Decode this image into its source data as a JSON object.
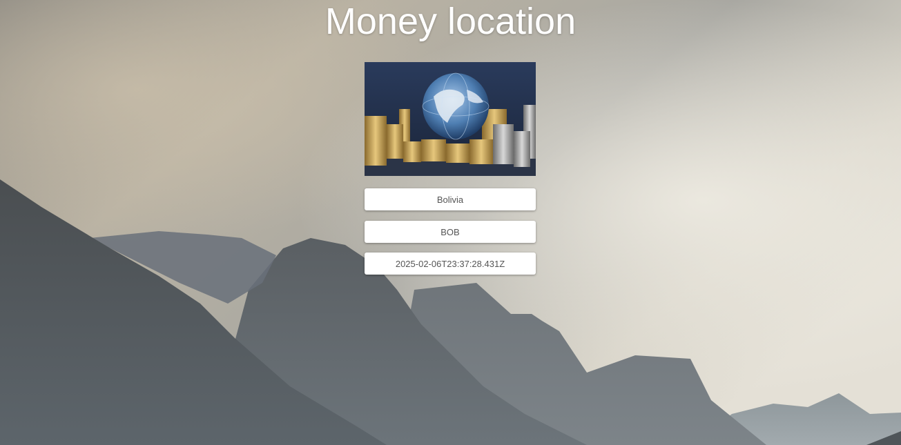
{
  "page": {
    "title": "Money location"
  },
  "info": {
    "country": "Bolivia",
    "currency": "BOB",
    "timestamp": "2025-02-06T23:37:28.431Z"
  },
  "image": {
    "subject": "globe-with-coin-stacks"
  }
}
